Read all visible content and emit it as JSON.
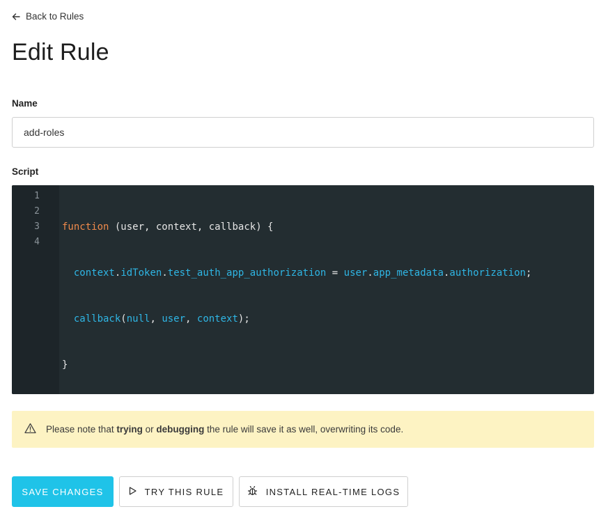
{
  "nav": {
    "back_label": "Back to Rules",
    "back_icon": "arrow-left-icon"
  },
  "page": {
    "title": "Edit Rule"
  },
  "form": {
    "name_label": "Name",
    "name_value": "add-roles",
    "script_label": "Script"
  },
  "editor": {
    "line_numbers": [
      "1",
      "2",
      "3",
      "4"
    ],
    "lines": [
      "function (user, context, callback) {",
      "  context.idToken.test_auth_app_authorization = user.app_metadata.authorization;",
      "  callback(null, user, context);",
      "}"
    ],
    "colors": {
      "background": "#232d31",
      "gutter": "#1d2529",
      "keyword": "#f08a4b",
      "identifier": "#2fb6e5",
      "text": "#e6e6e6"
    }
  },
  "notice": {
    "icon": "warning-icon",
    "text_prefix": "Please note that ",
    "bold_1": "trying",
    "text_mid": " or ",
    "bold_2": "debugging",
    "text_suffix": " the rule will save it as well, overwriting its code.",
    "background": "#fdf3c3"
  },
  "actions": {
    "save_label": "SAVE CHANGES",
    "try_label": "TRY THIS RULE",
    "try_icon": "play-icon",
    "logs_label": "INSTALL REAL-TIME LOGS",
    "logs_icon": "bug-icon",
    "accent": "#1fc3e8"
  }
}
